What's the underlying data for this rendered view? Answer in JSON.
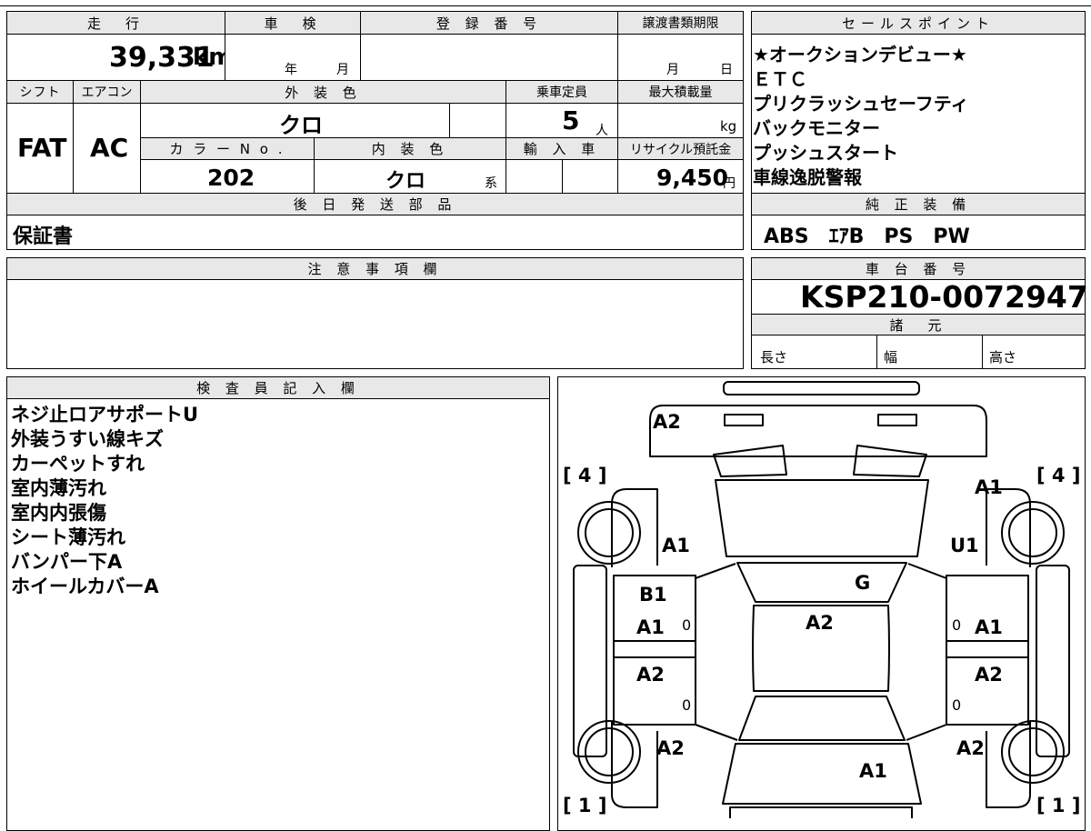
{
  "headers": {
    "mileage": "走　行",
    "shaken": "車　検",
    "registration": "登 録 番 号",
    "transfer_deadline": "譲渡書類期限",
    "sales_points": "セールスポイント",
    "shift": "シフト",
    "aircon": "エアコン",
    "exterior_color": "外 装 色",
    "capacity": "乗車定員",
    "max_load": "最大積載量",
    "color_no": "カ ラ ー N o .",
    "interior_color": "内 装 色",
    "import": "輸 入 車",
    "recycle": "リサイクル預託金",
    "later_parts": "後 日 発 送 部 品",
    "genuine_equipment": "純 正 装 備",
    "notes": "注 意 事 項 欄",
    "chassis_no": "車 台 番 号",
    "specs": "諸　元",
    "inspector": "検 査 員 記 入 欄"
  },
  "values": {
    "mileage": "39,331",
    "mileage_unit": "km",
    "shaken_year": "年",
    "shaken_month": "月",
    "deadline_month": "月",
    "deadline_day": "日",
    "shift": "FAT",
    "aircon": "AC",
    "exterior_color": "クロ",
    "capacity": "5",
    "capacity_unit": "人",
    "max_load_unit": "kg",
    "color_no": "202",
    "interior_color": "クロ",
    "interior_suffix": "系",
    "recycle": "9,450",
    "recycle_unit": "円",
    "later_parts": "保証書",
    "genuine_equipment": "ABS　ｴｱB　PS　PW",
    "chassis_no": "KSP210-0072947",
    "length": "長さ",
    "width": "幅",
    "height": "高さ"
  },
  "sales_points": [
    "★オークションデビュー★",
    "ＥＴＣ",
    "プリクラッシュセーフティ",
    "バックモニター",
    "プッシュスタート",
    "車線逸脱警報"
  ],
  "inspector_notes": [
    "ネジ止ロアサポートU",
    "外装うすい線キズ",
    "カーペットすれ",
    "室内薄汚れ",
    "室内内張傷",
    "シート薄汚れ",
    "バンパー下A",
    "ホイールカバーA"
  ],
  "diagram": {
    "front_bumper": "A2",
    "front_left_fender": "A1",
    "front_right_fender": "A1",
    "hood_right": "U1",
    "windshield": "G",
    "front_left_door_1": "B1",
    "front_left_door_2": "A1",
    "roof": "A2",
    "front_right_door": "A1",
    "rear_left_door": "A2",
    "rear_right_door": "A2",
    "rear_left_fender": "A2",
    "rear_right_fender": "A2",
    "rear": "A1",
    "zero": "0",
    "tire_fl": "[ 4 ]",
    "tire_fr": "[ 4 ]",
    "tire_rl": "[ 1 ]",
    "tire_rr": "[ 1 ]"
  }
}
